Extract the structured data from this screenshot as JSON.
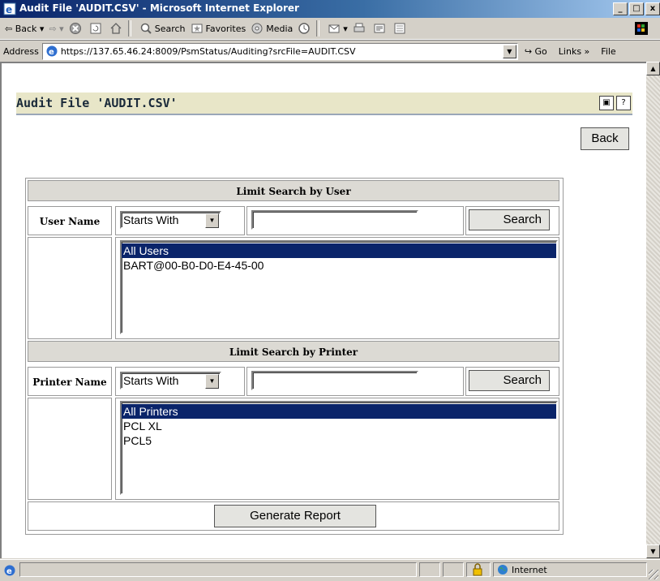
{
  "window": {
    "title": "Audit File 'AUDIT.CSV' - Microsoft Internet Explorer",
    "controls": [
      "_",
      "□",
      "x"
    ]
  },
  "toolbar": {
    "back": "Back",
    "search": "Search",
    "favorites": "Favorites",
    "media": "Media"
  },
  "address": {
    "label": "Address",
    "url": "https://137.65.46.24:8009/PsmStatus/Auditing?srcFile=AUDIT.CSV",
    "go": "Go",
    "links": "Links",
    "menu_file": "File"
  },
  "page": {
    "title": "Audit File 'AUDIT.CSV'",
    "back_button": "Back"
  },
  "user_section": {
    "heading": "Limit Search by User",
    "label": "User Name",
    "match_mode": "Starts With",
    "search_value": "",
    "search_button": "Search",
    "list": [
      "All Users",
      "BART@00-B0-D0-E4-45-00"
    ],
    "selected_index": 0
  },
  "printer_section": {
    "heading": "Limit Search by Printer",
    "label": "Printer Name",
    "match_mode": "Starts With",
    "search_value": "",
    "search_button": "Search",
    "list": [
      "All Printers",
      "PCL XL",
      "PCL5"
    ],
    "selected_index": 0
  },
  "generate_button": "Generate Report",
  "status": {
    "zone": "Internet"
  },
  "colors": {
    "selection": "#0a246a",
    "header_band": "#e8e6c8",
    "titlebar": "#0a246a"
  }
}
